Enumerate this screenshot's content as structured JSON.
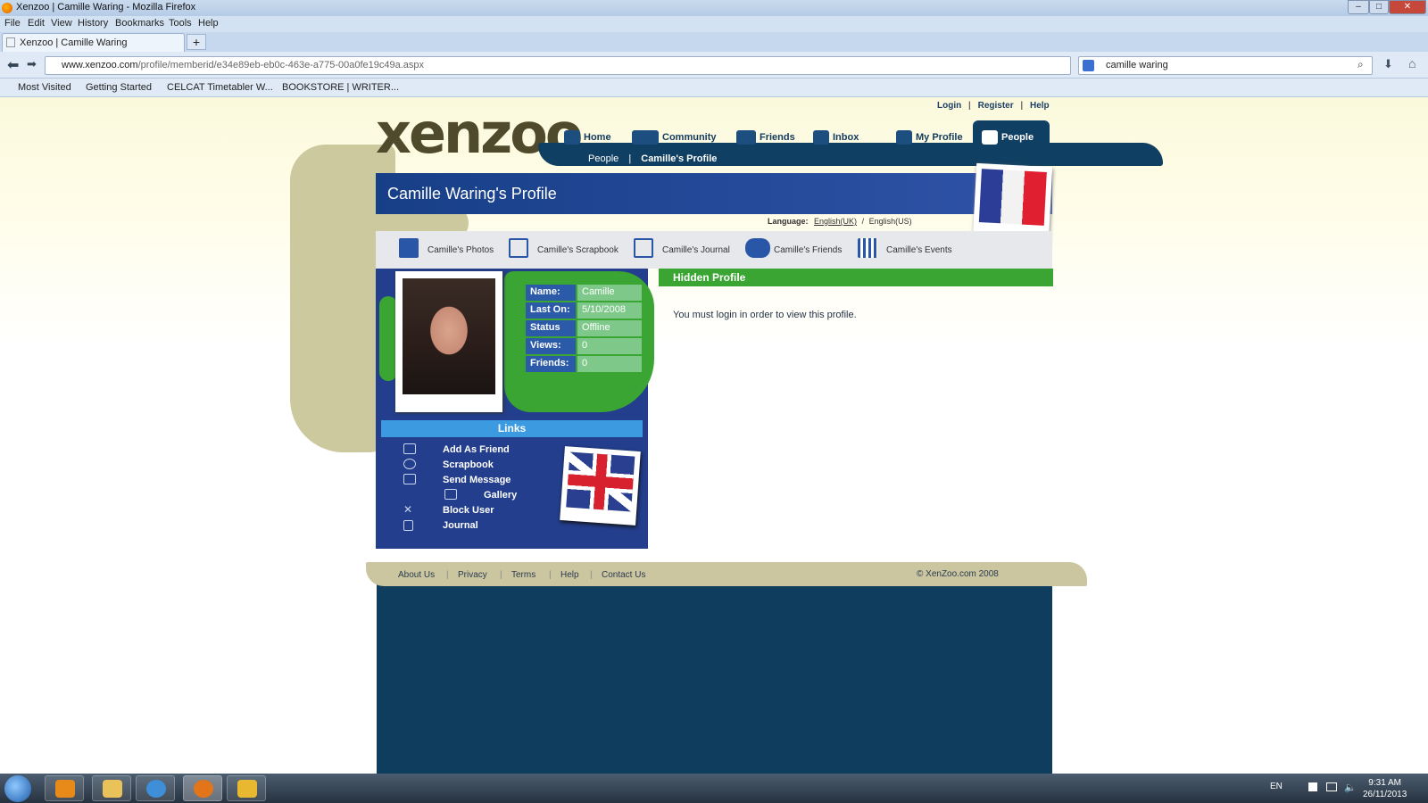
{
  "browser": {
    "window_title": "Xenzoo | Camille Waring - Mozilla Firefox",
    "menu": [
      "File",
      "Edit",
      "View",
      "History",
      "Bookmarks",
      "Tools",
      "Help"
    ],
    "tab_title": "Xenzoo | Camille Waring",
    "url_domain": "www.xenzoo.com",
    "url_path": "/profile/memberid/e34e89eb-eb0c-463e-a775-00a0fe19c49a.aspx",
    "search_query": "camille waring",
    "bookmarks": [
      "Most Visited",
      "Getting Started",
      "CELCAT Timetabler W...",
      "BOOKSTORE | WRITER..."
    ]
  },
  "site": {
    "logo": "xenzoo",
    "top_links": [
      "Login",
      "Register",
      "Help"
    ],
    "nav": [
      "Home",
      "Community",
      "Friends",
      "Inbox",
      "My Profile",
      "People"
    ],
    "subnav": [
      "People",
      "Camille's Profile"
    ],
    "profile_title": "Camille Waring's Profile",
    "language_label": "Language:",
    "language_uk": "English(UK)",
    "language_sep": "/",
    "language_us": "English(US)",
    "sub_tabs": [
      "Camille's Photos",
      "Camille's Scrapbook",
      "Camille's Journal",
      "Camille's Friends",
      "Camille's Events"
    ],
    "info": {
      "name_label": "Name:",
      "name": "Camille",
      "laston_label": "Last On:",
      "laston": "5/10/2008",
      "status_label": "Status",
      "status": "Offline",
      "views_label": "Views:",
      "views": "0",
      "friends_label": "Friends:",
      "friends": "0"
    },
    "links_title": "Links",
    "links": [
      "Add As Friend",
      "Scrapbook",
      "Send Message",
      "Gallery",
      "Block User",
      "Journal"
    ],
    "hidden_title": "Hidden Profile",
    "hidden_message": "You must login in order to view this profile.",
    "footer_links": [
      "About Us",
      "Privacy",
      "Terms",
      "Help",
      "Contact Us"
    ],
    "copyright": "© XenZoo.com 2008"
  },
  "taskbar": {
    "lang": "EN",
    "time": "9:31 AM",
    "date": "26/11/2013"
  },
  "colors": {
    "banner_blue": "#173f87",
    "nav_navy": "#0f3f62",
    "green": "#3aa533",
    "footer_khaki": "#cbc6a0"
  }
}
